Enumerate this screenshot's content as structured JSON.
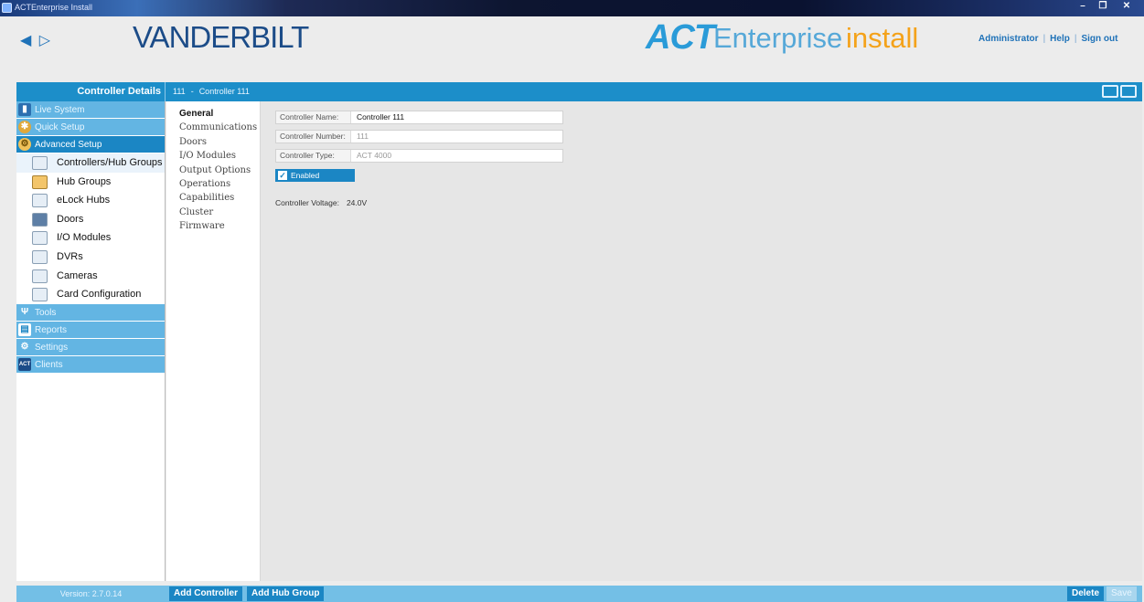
{
  "window": {
    "title": "ACTEnterprise Install",
    "controls": [
      "–",
      "❐",
      "✕"
    ]
  },
  "header": {
    "back_icon": "◀",
    "forward_icon": "▷",
    "brand_logo": "VANDERBILT",
    "product_logo_act": "ACT",
    "product_logo_enterprise": "Enterprise",
    "product_logo_install": "install",
    "links": {
      "administrator": "Administrator",
      "help": "Help",
      "sign_out": "Sign out"
    }
  },
  "strip": {
    "section": "Controller Details",
    "breadcrumb_id": "111",
    "breadcrumb_sep": "-",
    "breadcrumb_name": "Controller 111"
  },
  "nav": {
    "live_system": "Live System",
    "quick_setup": "Quick Setup",
    "advanced_setup": "Advanced Setup",
    "sub": {
      "controllers": "Controllers/Hub Groups",
      "hub_groups": "Hub Groups",
      "elock_hubs": "eLock Hubs",
      "doors": "Doors",
      "io_modules": "I/O Modules",
      "dvrs": "DVRs",
      "cameras": "Cameras",
      "card_config": "Card Configuration"
    },
    "tools": "Tools",
    "reports": "Reports",
    "settings": "Settings",
    "clients": "Clients",
    "clients_icon_text": "ACT"
  },
  "tabs": {
    "general": "General",
    "communications": "Communications",
    "doors": "Doors",
    "io_modules": "I/O Modules",
    "output_options": "Output Options",
    "operations": "Operations",
    "capabilities": "Capabilities",
    "cluster": "Cluster",
    "firmware": "Firmware"
  },
  "form": {
    "name_label": "Controller Name:",
    "name_value": "Controller 111",
    "number_label": "Controller Number:",
    "number_value": "111",
    "type_label": "Controller Type:",
    "type_value": "ACT 4000",
    "enabled_label": "Enabled",
    "enabled_checked": true,
    "voltage_label": "Controller Voltage:",
    "voltage_value": "24.0V"
  },
  "footer": {
    "version": "Version:  2.7.0.14",
    "add_controller": "Add Controller",
    "add_hub_group": "Add Hub Group",
    "delete": "Delete",
    "save": "Save"
  },
  "colors": {
    "accent": "#1c8ec9",
    "nav_group": "#63b5e3",
    "act_blue": "#2a9bd8",
    "install_orange": "#f4a21a",
    "brand_navy": "#1c4c88"
  }
}
